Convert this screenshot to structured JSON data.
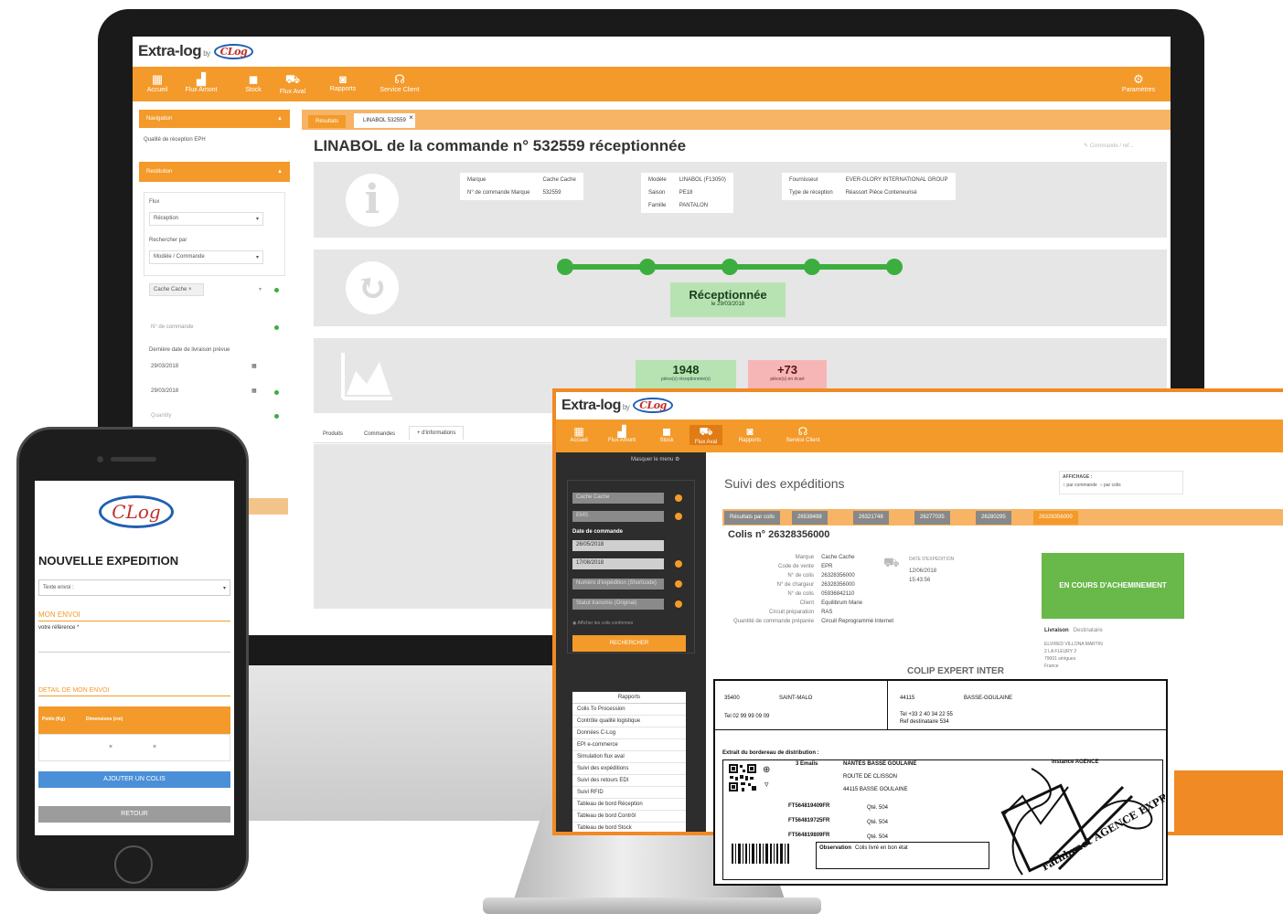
{
  "colors": {
    "accent": "#f39a2a",
    "accent_dark": "#f08a24",
    "success": "#3cae3f",
    "success_light": "#b7e3b3",
    "warning_light": "#f7b6b6",
    "mobile_blue": "#4a8fd8",
    "sidebar_dark": "#2d2d2d"
  },
  "brand": {
    "name": "Extra-log",
    "by": "by",
    "badge": "CLog",
    "mobile_badge": "CLog"
  },
  "desktop": {
    "nav": [
      {
        "label": "Accueil",
        "icon": "dashboard-icon"
      },
      {
        "label": "Flux Amont",
        "icon": "factory-icon"
      },
      {
        "label": "Stock",
        "icon": "boxes-icon"
      },
      {
        "label": "Flux Aval",
        "icon": "truck-icon"
      },
      {
        "label": "Rapports",
        "icon": "report-icon"
      },
      {
        "label": "Service Client",
        "icon": "headset-icon"
      }
    ],
    "settings_label": "Paramètres",
    "sidebar": {
      "navigation_title": "Navigation",
      "nav_item": "Qualité de réception EPH",
      "filter_title": "Restitution",
      "flux_label": "Flux",
      "flux_value": "Réception",
      "group_label": "Rechercher par",
      "group_value": "Modèle / Commande",
      "tag_value": "Cache Cache ×",
      "order_placeholder": "N° de commande",
      "date_label": "Dernière date de livraison prévue",
      "date_from": "29/03/2018",
      "date_to": "29/03/2018",
      "quantity_placeholder": "Quantity"
    },
    "tabs": [
      "Résultats",
      "LINABOL 532559"
    ],
    "search_placeholder": "Commande / ref...",
    "page_title": "LINABOL de la commande n° 532559 réceptionnée",
    "info": {
      "col1": [
        [
          "Marque",
          "Cache Cache"
        ],
        [
          "N° de commande Marque",
          "532559"
        ]
      ],
      "col2": [
        [
          "Modèle",
          "LINABOL (F13050)"
        ],
        [
          "Saison",
          "PE18"
        ],
        [
          "Famille",
          "PANTALON"
        ]
      ],
      "col3": [
        [
          "Fournisseur",
          "EVER-GLORY INTERNATIONAL GROUP"
        ],
        [
          "Type de réception",
          "Réassort Pièce Conteneurisé"
        ]
      ]
    },
    "status": {
      "label": "Réceptionnée",
      "date": "le 29/03/2018"
    },
    "stats": [
      {
        "value": "1948",
        "caption": "pièce(s) réceptionnée(s)"
      },
      {
        "value": "+73",
        "caption": "pièce(s) en écart"
      }
    ],
    "bottom_tabs": [
      "Produits",
      "Commandes",
      "+ d'informations"
    ]
  },
  "mobile": {
    "title": "NOUVELLE EXPEDITION",
    "dropdown_placeholder": "Texte envoi :",
    "section_label": "MON ENVOI",
    "reference_label": "votre référence *",
    "detail_label": "DETAIL DE MON ENVOI",
    "table_headers": [
      "Poids (Kg)",
      "Dimensions (cm)"
    ],
    "add_button": "AJOUTER UN COLIS",
    "back_button": "RETOUR"
  },
  "laptop": {
    "nav": [
      {
        "label": "Accueil",
        "icon": "dashboard-icon"
      },
      {
        "label": "Flux Amont",
        "icon": "factory-icon"
      },
      {
        "label": "Stock",
        "icon": "boxes-icon"
      },
      {
        "label": "Flux Aval",
        "icon": "truck-icon"
      },
      {
        "label": "Rapports",
        "icon": "report-icon"
      },
      {
        "label": "Service Client",
        "icon": "headset-icon"
      }
    ],
    "sidebar_toggle": "Masquer le menu",
    "filters": {
      "brand": "Cache Cache",
      "carrier": "EMS",
      "date_label": "Date de commande",
      "date_from": "26/05/2018",
      "date_to": "17/08/2018",
      "search1": "Numéro d'expédition (Shortcode)",
      "search2": "Statut transmis (Original)",
      "checkbox": "Afficher les colis conformes",
      "button": "RECHERCHER"
    },
    "reports_title": "Rapports",
    "reports": [
      "Colis To Procession",
      "Contrôle qualité logistique",
      "Données C-Log",
      "EPI e-commerce",
      "Simulation flux aval",
      "Suivi des expéditions",
      "Suivi des retours EDI",
      "Suivi RFID",
      "Tableau de bord Réception",
      "Tableau de bord Contrôl",
      "Tableau de bord Stock"
    ],
    "page_title": "Suivi des expéditions",
    "display_label": "AFFICHAGE :",
    "display_options": [
      "par commande",
      "par colis"
    ],
    "tabs": [
      "Résultats par colis",
      "26538498",
      "26321748",
      "26277035",
      "26280295",
      "26328356000"
    ],
    "parcel_title": "Colis n° 26328356000",
    "parcel_fields": [
      [
        "Marque",
        "Cache Cache"
      ],
      [
        "Code de vente",
        "EPR"
      ],
      [
        "N° de colis",
        "26328356000"
      ],
      [
        "N° de chargeur",
        "26328356000"
      ],
      [
        "N° de colis",
        "05936842110"
      ],
      [
        "Client",
        "Equilibrum Marie"
      ],
      [
        "Circuit préparation",
        "RAS"
      ],
      [
        "Quantité de commande préparée",
        "Circuit Reprogrammé Internet"
      ]
    ],
    "shipping_label": "DATE D'EXPÉDITION",
    "shipping_date": "12/06/2018",
    "shipping_time": "15:43:56",
    "carrier_name": "COLIP EXPERT INTER",
    "status": "EN COURS D'ACHEMINEMENT",
    "dest_tabs": [
      "Livraison",
      "Destinataire"
    ],
    "dest_lines": [
      "ELVIRED VILLONA MARTIN",
      "2 LA FLEURY 2",
      "79001 sérigues",
      "France"
    ]
  },
  "document": {
    "sender_cp": "35400",
    "sender_city": "SAINT-MALO",
    "sender_phone": "Tel 02 99 99 09 09",
    "recipient_cp": "44115",
    "recipient_city": "BASSE-GOULAINE",
    "recipient_phone": "Tel +33 2 40 34 22 55",
    "recipient_ref": "Ref destinataire 534",
    "extract_title": "Extrait du bordereau de distribution :",
    "entry_label": "3 Emails",
    "site_name": "NANTES BASSE GOULAINE",
    "address": "ROUTE DE CLISSON",
    "city": "44115 BASSE GOULAINE",
    "agency": "Instance AGENCE",
    "parcels": [
      "FT564819409FR",
      "FT564819725FR",
      "FT564819809FR"
    ],
    "qty_label": "Qté. 504",
    "note_label": "Observation",
    "note_text": "Colis livré en bon état",
    "stamp": "Fathhrnet AGENCE EXPRESS"
  }
}
